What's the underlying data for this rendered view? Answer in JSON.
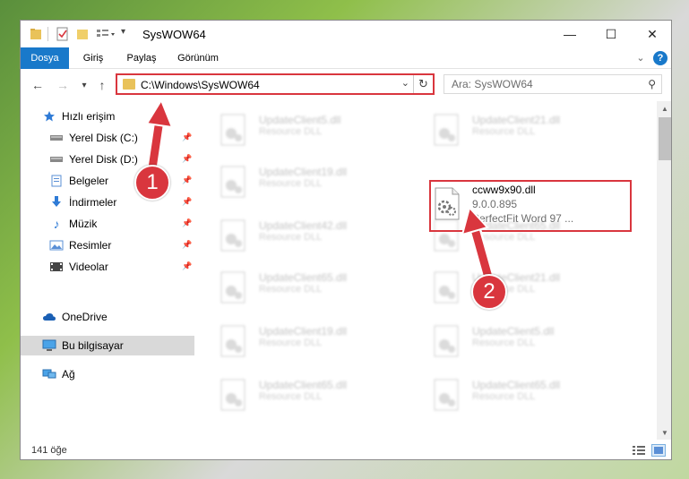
{
  "window": {
    "title": "SysWOW64"
  },
  "ribbon": {
    "tabs": [
      {
        "label": "Dosya",
        "active": true
      },
      {
        "label": "Giriş",
        "active": false
      },
      {
        "label": "Paylaş",
        "active": false
      },
      {
        "label": "Görünüm",
        "active": false
      }
    ]
  },
  "navbar": {
    "address": "C:\\Windows\\SysWOW64",
    "search_placeholder": "Ara: SysWOW64"
  },
  "sidebar": {
    "items": [
      {
        "label": "Hızlı erişim",
        "icon": "star-icon"
      },
      {
        "label": "Yerel Disk (C:)",
        "icon": "drive-icon",
        "pinned": true
      },
      {
        "label": "Yerel Disk (D:)",
        "icon": "drive-icon",
        "pinned": true
      },
      {
        "label": "Belgeler",
        "icon": "documents-icon",
        "pinned": true
      },
      {
        "label": "İndirmeler",
        "icon": "download-icon",
        "pinned": true
      },
      {
        "label": "Müzik",
        "icon": "music-icon",
        "pinned": true
      },
      {
        "label": "Resimler",
        "icon": "pictures-icon",
        "pinned": true
      },
      {
        "label": "Videolar",
        "icon": "videos-icon",
        "pinned": true
      },
      {
        "label": "OneDrive",
        "icon": "cloud-icon"
      },
      {
        "label": "Bu bilgisayar",
        "icon": "computer-icon",
        "selected": true
      },
      {
        "label": "Ağ",
        "icon": "network-icon"
      }
    ]
  },
  "files": {
    "blurred": [
      {
        "name": "UpdateClient5.dll",
        "desc": "Resource DLL"
      },
      {
        "name": "UpdateClient21.dll",
        "desc": "Resource DLL"
      },
      {
        "name": "UpdateClient19.dll",
        "desc": "Resource DLL"
      },
      {
        "name": "UpdateClient42.dll",
        "desc": "Resource DLL"
      },
      {
        "name": "UpdateClient65.dll",
        "desc": "Resource DLL"
      },
      {
        "name": "UpdateClient65.dll",
        "desc": "Resource DLL"
      },
      {
        "name": "UpdateClient21.dll",
        "desc": "Resource DLL"
      },
      {
        "name": "UpdateClient19.dll",
        "desc": "Resource DLL"
      },
      {
        "name": "UpdateClient5.dll",
        "desc": "Resource DLL"
      },
      {
        "name": "UpdateClient65.dll",
        "desc": "Resource DLL"
      },
      {
        "name": "UpdateClient65.dll",
        "desc": "Resource DLL"
      }
    ],
    "highlighted": {
      "name": "ccww9x90.dll",
      "version": "9.0.0.895",
      "description": "PerfectFit Word 97 ..."
    }
  },
  "statusbar": {
    "count": "141 öğe"
  },
  "callouts": {
    "one": "1",
    "two": "2"
  },
  "colors": {
    "accent": "#1979ca",
    "callout": "#d9363e"
  }
}
